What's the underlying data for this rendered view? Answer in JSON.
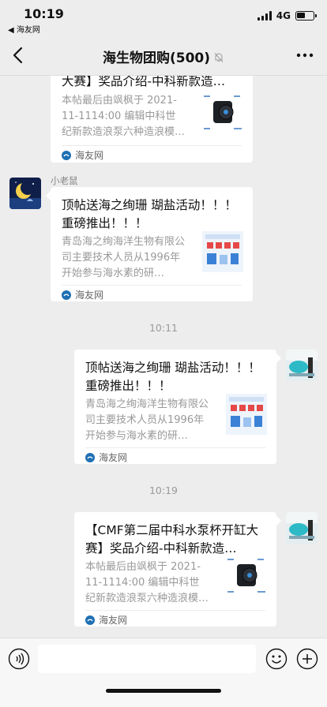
{
  "status_bar": {
    "time": "10:19",
    "back_label": "◀ 海友网",
    "network": "4G"
  },
  "nav": {
    "title": "海生物团购(500)"
  },
  "messages": [
    {
      "title": "大赛】奖品介绍-中科新款造…",
      "desc": "本帖最后由飒枫于 2021-11-1114:00 编辑中科世纪新款造浪泵六种造浪模…",
      "source": "海友网"
    },
    {
      "sender": "小老鼠",
      "title": "顶帖送海之绚珊 瑚盐活动！！！ 重磅推出！！！",
      "desc": "青岛海之绚海洋生物有限公司主要技术人员从1996年开始参与海水素的研…",
      "source": "海友网"
    },
    {
      "timestamp": "10:11",
      "title": "顶帖送海之绚珊 瑚盐活动！！！ 重磅推出！！！",
      "desc": "青岛海之绚海洋生物有限公司主要技术人员从1996年开始参与海水素的研…",
      "source": "海友网"
    },
    {
      "timestamp": "10:19",
      "title": "【CMF第二届中科水泵杯开缸大赛】奖品介绍-中科新款造…",
      "desc": "本帖最后由飒枫于 2021-11-1114:00 编辑中科世纪新款造浪泵六种造浪模…",
      "source": "海友网"
    }
  ],
  "icons": {
    "back": "chevron-left-icon",
    "mute": "bell-off-icon",
    "more": "more-dots-icon",
    "voice": "voice-icon",
    "emoji": "emoji-icon",
    "plus": "plus-icon"
  },
  "colors": {
    "background": "#ededed",
    "bubble": "#ffffff",
    "source_icon": "#1f6fb3"
  }
}
